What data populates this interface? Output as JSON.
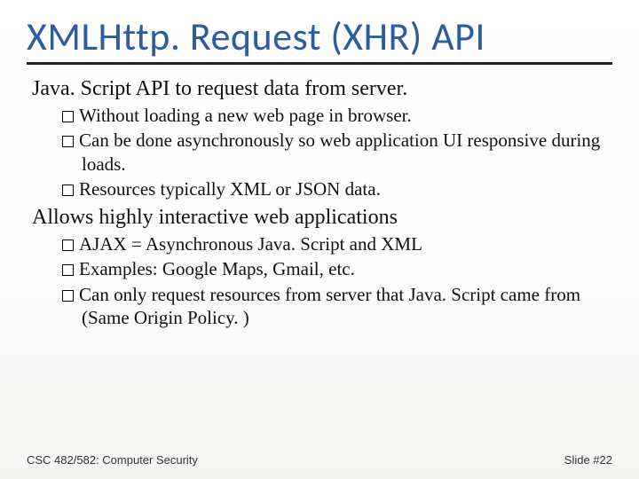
{
  "title": "XMLHttp. Request (XHR) API",
  "sections": [
    {
      "heading": "Java. Script API to request data from server.",
      "items": [
        "Without loading a new web page in browser.",
        "Can be done asynchronously so web application UI responsive during loads.",
        "Resources typically XML or JSON data."
      ]
    },
    {
      "heading": "Allows highly interactive web applications",
      "items": [
        "AJAX = Asynchronous Java. Script and XML",
        "Examples: Google Maps, Gmail, etc.",
        "Can only request resources from server that Java. Script came from (Same Origin Policy. )"
      ]
    }
  ],
  "footer": {
    "left": "CSC 482/582: Computer Security",
    "right": "Slide #22"
  }
}
